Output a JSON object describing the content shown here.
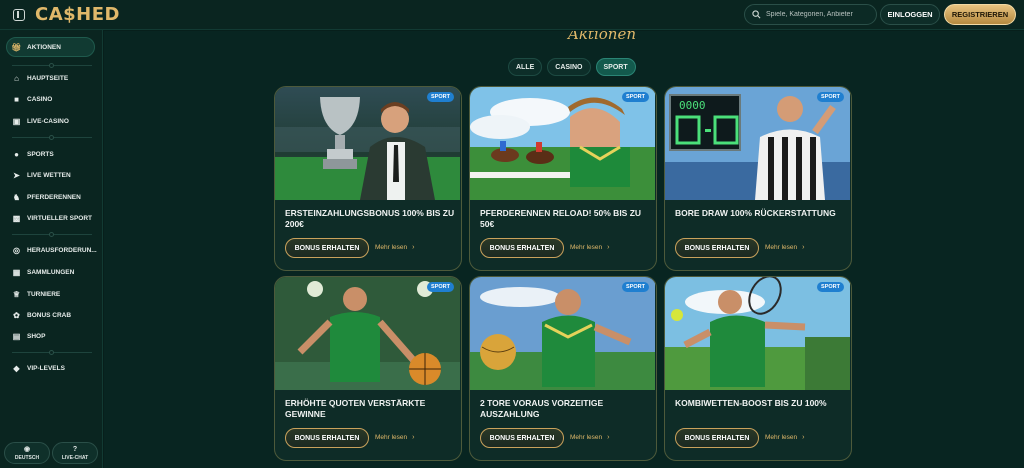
{
  "header": {
    "logo": "CA$HED",
    "search_placeholder": "Spiele, Kategorien, Anbieter",
    "login_label": "EINLOGGEN",
    "register_label": "REGISTRIEREN"
  },
  "sidebar": {
    "active_label": "AKTIONEN",
    "group1": [
      "HAUPTSEITE",
      "CASINO",
      "LIVE-CASINO"
    ],
    "group2": [
      "SPORTS",
      "LIVE WETTEN",
      "PFERDERENNEN",
      "VIRTUELLER SPORT"
    ],
    "group3": [
      "HERAUSFORDERUN...",
      "SAMMLUNGEN",
      "TURNIERE",
      "BONUS CRAB",
      "SHOP"
    ],
    "group4": [
      "VIP-LEVELS"
    ],
    "bottom": {
      "language": "DEUTSCH",
      "chat": "LIVE-CHAT"
    }
  },
  "main": {
    "heading": "Aktionen",
    "filters": [
      "ALLE",
      "CASINO",
      "SPORT"
    ],
    "active_filter": "SPORT"
  },
  "cards": [
    {
      "badge": "SPORT",
      "title": "ERSTEINZAHLUNGSBONUS 100% BIS ZU 200€",
      "button": "BONUS ERHALTEN",
      "more": "Mehr lesen"
    },
    {
      "badge": "SPORT",
      "title": "PFERDERENNEN RELOAD! 50% BIS ZU 50€",
      "button": "BONUS ERHALTEN",
      "more": "Mehr lesen"
    },
    {
      "badge": "SPORT",
      "title": "BORE DRAW 100% RÜCKERSTATTUNG",
      "button": "BONUS ERHALTEN",
      "more": "Mehr lesen"
    },
    {
      "badge": "SPORT",
      "title": "ERHÖHTE QUOTEN VERSTÄRKTE GEWINNE",
      "button": "BONUS ERHALTEN",
      "more": "Mehr lesen"
    },
    {
      "badge": "SPORT",
      "title": "2 TORE VORAUS VORZEITIGE AUSZAHLUNG",
      "button": "BONUS ERHALTEN",
      "more": "Mehr lesen"
    },
    {
      "badge": "SPORT",
      "title": "KOMBIWETTEN-BOOST BIS ZU 100%",
      "button": "BONUS ERHALTEN",
      "more": "Mehr lesen"
    }
  ],
  "scoreboard": "0000",
  "colors": {
    "accent_gold": "#e0b86a",
    "background": "#071f1b",
    "badge_blue": "#1f7fd0",
    "active_chip": "#135a4d"
  }
}
